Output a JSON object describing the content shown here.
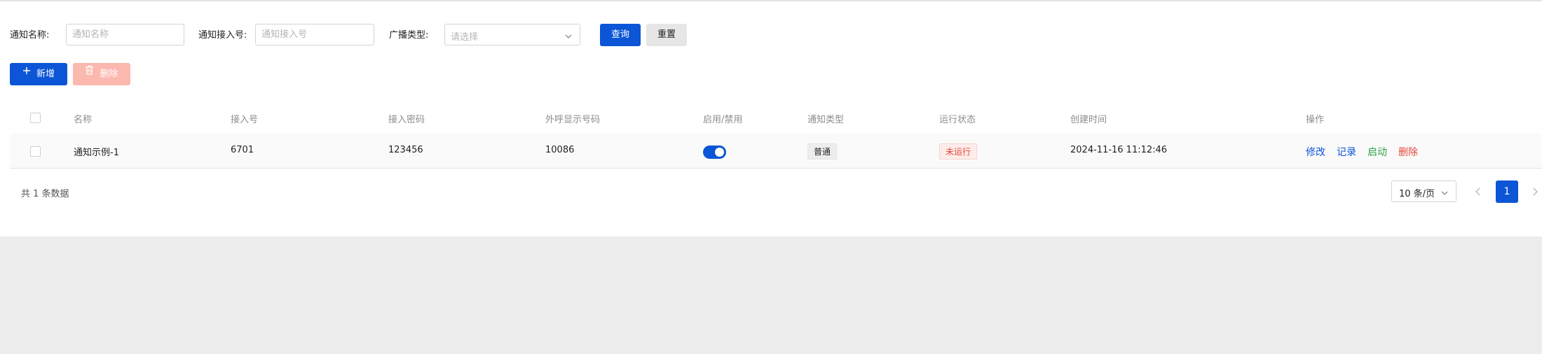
{
  "search": {
    "name_label": "通知名称:",
    "name_placeholder": "通知名称",
    "number_label": "通知接入号:",
    "number_placeholder": "通知接入号",
    "type_label": "广播类型:",
    "type_placeholder": "请选择",
    "query_label": "查询",
    "reset_label": "重置"
  },
  "toolbar": {
    "add_label": "新增",
    "delete_label": "删除"
  },
  "table": {
    "columns": [
      "名称",
      "接入号",
      "接入密码",
      "外呼显示号码",
      "启用/禁用",
      "通知类型",
      "运行状态",
      "创建时间",
      "操作"
    ],
    "rows": [
      {
        "name": "通知示例-1",
        "access_number": "6701",
        "access_password": "123456",
        "display_number": "10086",
        "enabled": true,
        "notify_type": "普通",
        "run_status": "未运行",
        "created_at": "2024-11-16 11:12:46",
        "actions": [
          "修改",
          "记录",
          "启动",
          "删除"
        ]
      }
    ]
  },
  "pagination": {
    "total_text": "共 1 条数据",
    "page_size": "10 条/页",
    "current_page": "1"
  },
  "colors": {
    "primary": "#0b55d6",
    "danger": "#e5473b",
    "success": "#2fa34a",
    "disabled_danger": "#fbb8ae"
  }
}
